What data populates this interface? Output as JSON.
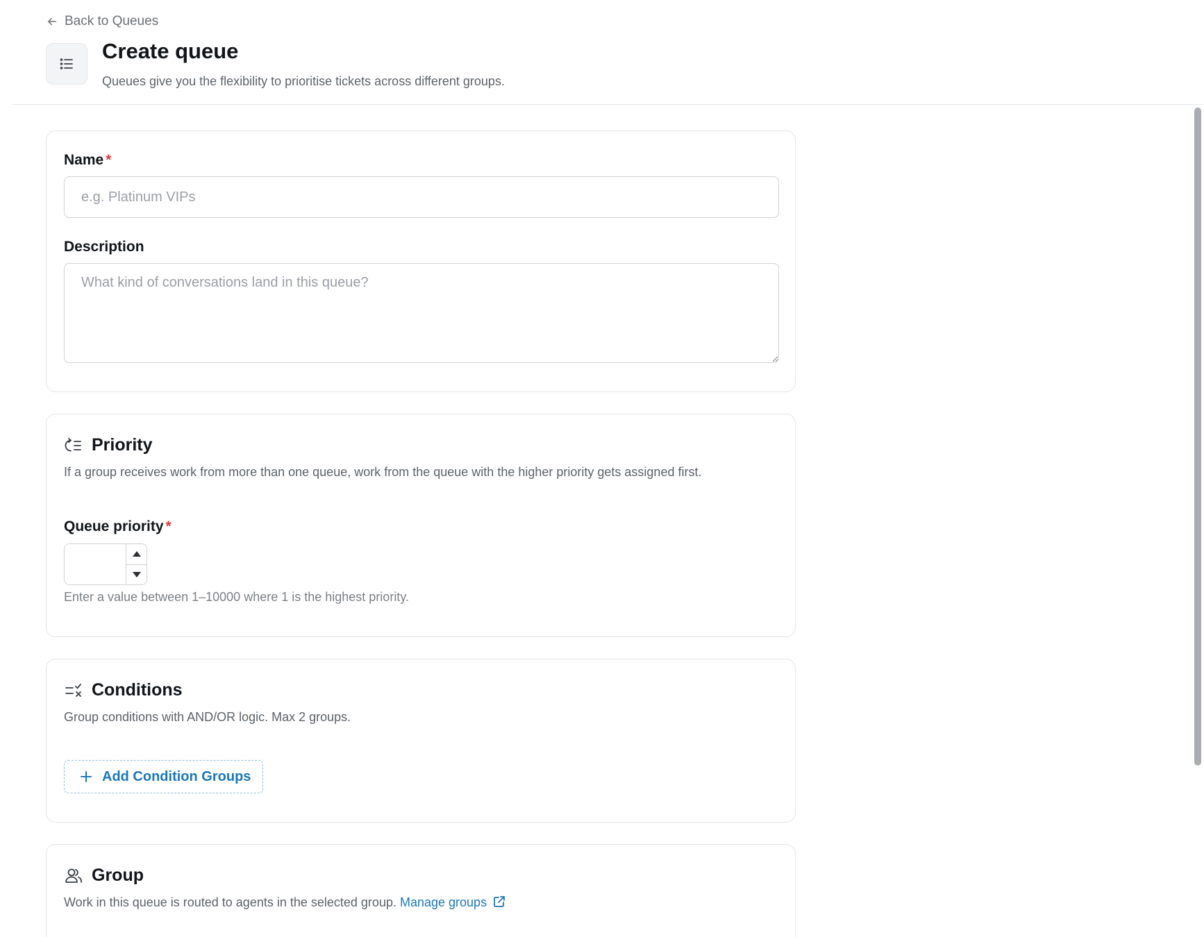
{
  "header": {
    "back_label": "Back to Queues",
    "title": "Create queue",
    "subtitle": "Queues give you the flexibility to prioritise tickets across different groups."
  },
  "basic": {
    "name_label": "Name",
    "name_value": "",
    "name_placeholder": "e.g. Platinum VIPs",
    "description_label": "Description",
    "description_value": "",
    "description_placeholder": "What kind of conversations land in this queue?"
  },
  "priority": {
    "title": "Priority",
    "description": "If a group receives work from more than one queue, work from the queue with the higher priority gets assigned first.",
    "field_label": "Queue priority",
    "value": "",
    "hint": "Enter a value between 1–10000 where 1 is the highest priority."
  },
  "conditions": {
    "title": "Conditions",
    "description": "Group conditions with AND/OR logic. Max 2 groups.",
    "add_button": "Add Condition Groups"
  },
  "group": {
    "title": "Group",
    "description": "Work in this queue is routed to agents in the selected group.",
    "manage_link": "Manage groups"
  },
  "required_marker": "*",
  "colors": {
    "accent": "#1b77b8",
    "required": "#d93b3b",
    "border": "#cfd2d6"
  },
  "icons": {
    "back": "arrow-left-icon",
    "header": "list-icon",
    "priority": "priority-sort-icon",
    "conditions": "conditions-check-icon",
    "group": "users-icon",
    "add": "plus-icon",
    "external": "external-link-icon"
  }
}
